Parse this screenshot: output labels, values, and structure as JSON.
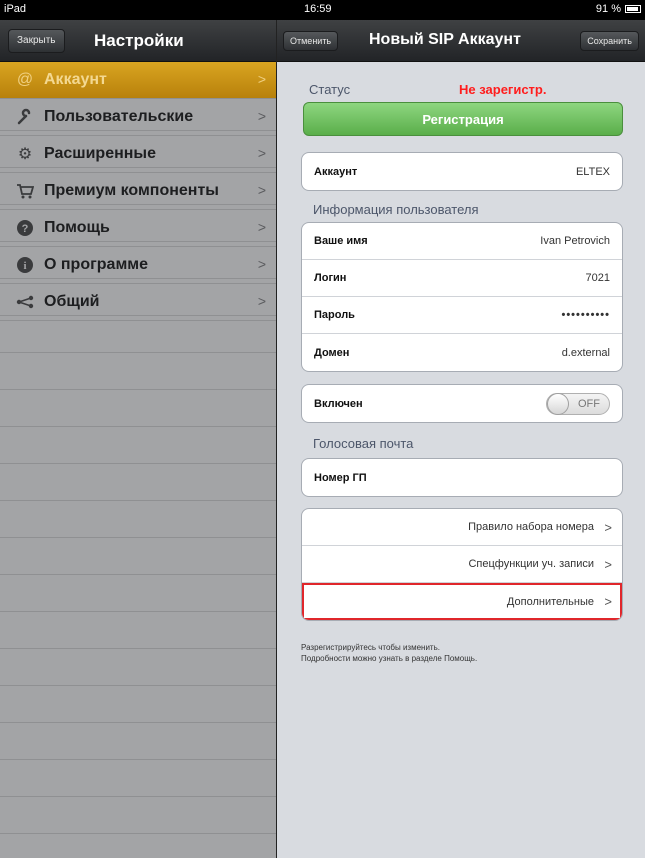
{
  "status_bar": {
    "device": "iPad",
    "time": "16:59",
    "battery": "91 %"
  },
  "left_panel": {
    "close_label": "Закрыть",
    "title": "Настройки",
    "items": [
      {
        "label": "Аккаунт",
        "icon": "at-icon",
        "active": true
      },
      {
        "label": "Пользовательские",
        "icon": "wrench-icon",
        "active": false
      },
      {
        "label": "Расширенные",
        "icon": "gears-icon",
        "active": false
      },
      {
        "label": "Премиум компоненты",
        "icon": "cart-icon",
        "active": false
      },
      {
        "label": "Помощь",
        "icon": "help-icon",
        "active": false
      },
      {
        "label": "О программе",
        "icon": "info-icon",
        "active": false
      },
      {
        "label": "Общий",
        "icon": "share-icon",
        "active": false
      }
    ]
  },
  "right_panel": {
    "cancel_label": "Отменить",
    "title": "Новый SIP Аккаунт",
    "save_label": "Сохранить",
    "status_label": "Статус",
    "status_value": "Не зарегистр.",
    "register_label": "Регистрация",
    "account": {
      "label": "Аккаунт",
      "value": "ELTEX"
    },
    "user_info_title": "Информация пользователя",
    "user_info": [
      {
        "label": "Ваше имя",
        "value": "Ivan Petrovich"
      },
      {
        "label": "Логин",
        "value": "7021"
      },
      {
        "label": "Пароль",
        "value": "••••••••••"
      },
      {
        "label": "Домен",
        "value": "d.external"
      }
    ],
    "enabled": {
      "label": "Включен",
      "toggle_text": "OFF"
    },
    "voicemail_title": "Голосовая почта",
    "voicemail": {
      "label": "Номер ГП"
    },
    "links": [
      {
        "label": "Правило набора номера",
        "highlighted": false
      },
      {
        "label": "Спецфункции уч. записи",
        "highlighted": false
      },
      {
        "label": "Дополнительные",
        "highlighted": true
      }
    ],
    "footnote_line1": "Разрегистрируйтесь чтобы изменить.",
    "footnote_line2": "Подробности можно узнать в разделе Помощь."
  },
  "colors": {
    "active_item": "#c8940f",
    "status_value": "#ff1d1d",
    "register_button": "#6cbf5b",
    "highlight_outline": "#e0262b"
  }
}
